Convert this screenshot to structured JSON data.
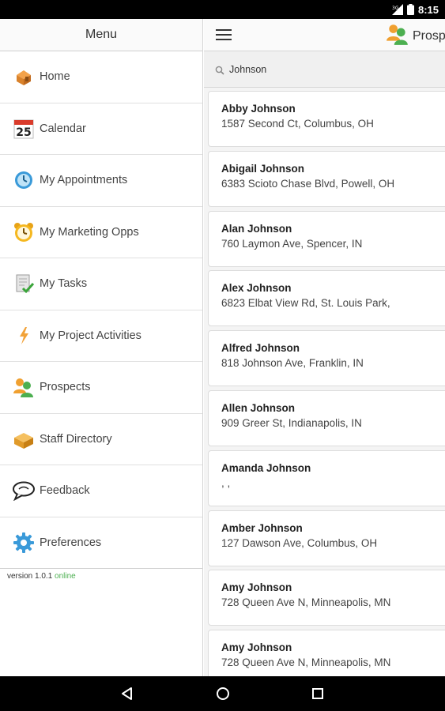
{
  "status_bar": {
    "time": "8:15",
    "network": "3G"
  },
  "drawer": {
    "title": "Menu",
    "items": [
      {
        "label": "Home",
        "icon": "home-icon"
      },
      {
        "label": "Calendar",
        "icon": "calendar-icon",
        "calendar_day": "25"
      },
      {
        "label": "My Appointments",
        "icon": "appointments-icon"
      },
      {
        "label": "My Marketing Opps",
        "icon": "alarm-clock-icon"
      },
      {
        "label": "My Tasks",
        "icon": "tasks-icon"
      },
      {
        "label": "My Project Activities",
        "icon": "project-activities-icon"
      },
      {
        "label": "Prospects",
        "icon": "prospects-icon"
      },
      {
        "label": "Staff Directory",
        "icon": "staff-directory-icon"
      },
      {
        "label": "Feedback",
        "icon": "feedback-icon"
      },
      {
        "label": "Preferences",
        "icon": "gear-icon"
      }
    ],
    "version_label": "version 1.0.1",
    "status_label": "online"
  },
  "topbar": {
    "title": "Prosp"
  },
  "search": {
    "value": "Johnson"
  },
  "results": [
    {
      "name": "Abby Johnson",
      "address": "1587 Second Ct, Columbus, OH"
    },
    {
      "name": "Abigail Johnson",
      "address": "6383 Scioto Chase Blvd, Powell, OH"
    },
    {
      "name": "Alan Johnson",
      "address": "760 Laymon Ave, Spencer, IN"
    },
    {
      "name": "Alex Johnson",
      "address": "6823 Elbat View Rd, St. Louis Park,"
    },
    {
      "name": "Alfred Johnson",
      "address": "818 Johnson Ave, Franklin, IN"
    },
    {
      "name": "Allen Johnson",
      "address": "909 Greer St, Indianapolis, IN"
    },
    {
      "name": "Amanda Johnson",
      "address": ", ,"
    },
    {
      "name": "Amber Johnson",
      "address": "127 Dawson Ave, Columbus, OH"
    },
    {
      "name": "Amy Johnson",
      "address": "728 Queen Ave N, Minneapolis, MN"
    },
    {
      "name": "Amy Johnson",
      "address": "728 Queen Ave N, Minneapolis, MN"
    }
  ],
  "colors": {
    "online": "#4caf50",
    "status_bar": "#000000",
    "accent_blue": "#3a9ad9"
  }
}
